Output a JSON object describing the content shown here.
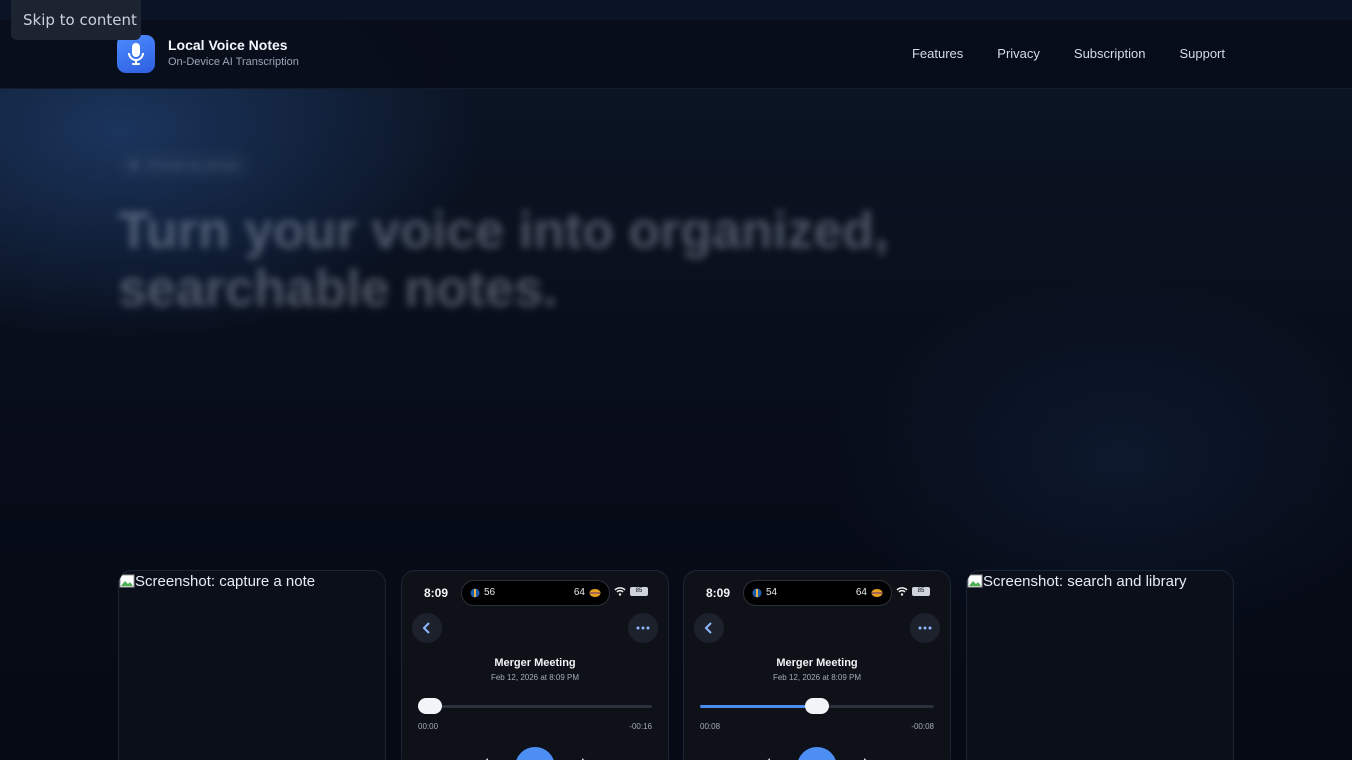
{
  "skip_link": "Skip to content",
  "brand": {
    "name": "Local Voice Notes",
    "tagline": "On-Device AI Transcription",
    "icon": "microphone-icon",
    "accent": "#3f78f0"
  },
  "nav": [
    "Features",
    "Privacy",
    "Subscription",
    "Support"
  ],
  "hero": {
    "badge": "Private by design",
    "headline": "Turn your voice into organized, searchable notes."
  },
  "screenshots": [
    {
      "alt": "Screenshot: capture a note"
    },
    {
      "phone": {
        "time": "8:09",
        "island_left": "56",
        "island_right": "64",
        "battery": "85",
        "note_title": "Merger Meeting",
        "note_date": "Feb 12, 2026 at 8:09 PM",
        "elapsed": "00:00",
        "remaining": "-00:16",
        "progress": 0.05
      }
    },
    {
      "phone": {
        "time": "8:09",
        "island_left": "54",
        "island_right": "64",
        "battery": "85",
        "note_title": "Merger Meeting",
        "note_date": "Feb 12, 2026 at 8:09 PM",
        "elapsed": "00:08",
        "remaining": "-00:08",
        "progress": 0.5
      }
    },
    {
      "alt": "Screenshot: search and library"
    }
  ]
}
